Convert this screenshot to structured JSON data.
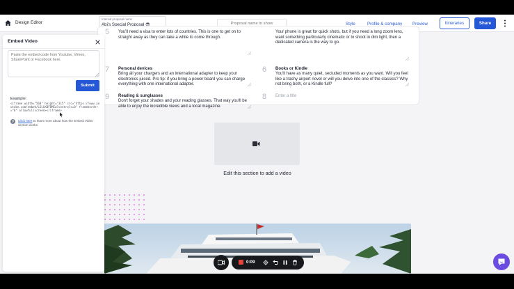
{
  "header": {
    "app_title": "Design Editor",
    "proposal_name_label": "Internal proposal name",
    "proposal_name_value": "Abi's Special Proposal 😎",
    "show_name_placeholder": "Proposal name to show",
    "nav": {
      "style": "Style",
      "profile": "Profile & company",
      "preview": "Preview"
    },
    "itineraries_label": "Itineraries",
    "share_label": "Share"
  },
  "packing_list": [
    {
      "number": "5",
      "title": "",
      "desc": "You'll need a visa to enter lots of countries. This is one to get on to straight away as they can take a while to come through."
    },
    {
      "number": "",
      "title": "",
      "desc": "Your phone is great for quick shots, but if you need a long zoom lens, want something particularly cinematic or to shoot in dim light, then a dedicated camera is the way to go."
    },
    {
      "number": "7",
      "title": "Personal devices",
      "desc": "Bring all your chargers and an international adapter to keep your electronics juiced. Pro tip: if you bring a power board you can charge everything with one international adapter."
    },
    {
      "number": "6",
      "title": "Books or Kindle",
      "desc": "You'll have as many quiet, secluded moments as you want. Will you feel like a trashy airport novel or will you delve into one of the classics? Why not bring both, or a Kindle full?"
    },
    {
      "number": "9",
      "title": "Reading & sunglasses",
      "desc": "Don't forget your shades and your reading glasses. That way you'll be able to enjoy the incredible views and a local magazine."
    },
    {
      "number": "8",
      "title": "",
      "placeholder": "Enter a title"
    }
  ],
  "video_section": {
    "caption": "Edit this section to add a video"
  },
  "embed_panel": {
    "title": "Embed Video",
    "textarea_placeholder": "Paste the embed code from Youtube, Vimeo, SharePoint or Facebook here.",
    "submit_label": "Submit",
    "example_label": "Example:",
    "example_code": "<iframe width=\"560\" height=\"315\" src=\"https://www.youtube.com/embed/LSLLKBFBMEw?controls=0\" frameborder=\"0\" allowfullscreen></iframe>",
    "help_link": "Click here",
    "help_text": " to learn more about how the Embed Video section works."
  },
  "recorder": {
    "time": "0:09"
  },
  "colors": {
    "accent": "#2458d6",
    "recorder_stop": "#e0443a",
    "chat": "#6a4de0",
    "dots": "#d563d9"
  }
}
